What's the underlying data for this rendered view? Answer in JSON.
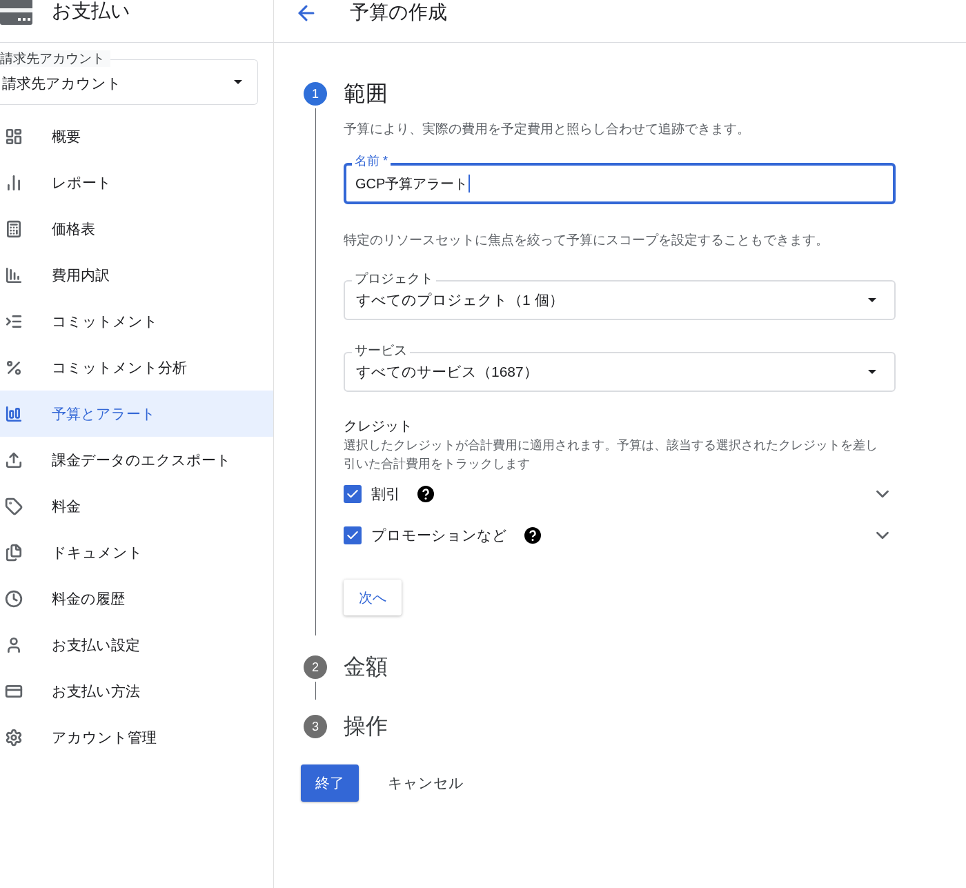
{
  "sidebar": {
    "title": "お支払い",
    "account_select": {
      "label": "請求先アカウント",
      "value": "請求先アカウント"
    },
    "items": [
      {
        "label": "概要",
        "selected": false
      },
      {
        "label": "レポート",
        "selected": false
      },
      {
        "label": "価格表",
        "selected": false
      },
      {
        "label": "費用内訳",
        "selected": false
      },
      {
        "label": "コミットメント",
        "selected": false
      },
      {
        "label": "コミットメント分析",
        "selected": false
      },
      {
        "label": "予算とアラート",
        "selected": true
      },
      {
        "label": "課金データのエクスポート",
        "selected": false
      },
      {
        "label": "料金",
        "selected": false
      },
      {
        "label": "ドキュメント",
        "selected": false
      },
      {
        "label": "料金の履歴",
        "selected": false
      },
      {
        "label": "お支払い設定",
        "selected": false
      },
      {
        "label": "お支払い方法",
        "selected": false
      },
      {
        "label": "アカウント管理",
        "selected": false
      }
    ]
  },
  "header": {
    "title": "予算の作成"
  },
  "steps": [
    {
      "number": "1",
      "title": "範囲",
      "active": true
    },
    {
      "number": "2",
      "title": "金額",
      "active": false
    },
    {
      "number": "3",
      "title": "操作",
      "active": false
    }
  ],
  "scope": {
    "description": "予算により、実際の費用を予定費用と照らし合わせて追跡できます。",
    "name_field": {
      "label": "名前 *",
      "value": "GCP予算アラート"
    },
    "filter_hint": "特定のリソースセットに焦点を絞って予算にスコープを設定することもできます。",
    "selects": [
      {
        "label": "プロジェクト",
        "value": "すべてのプロジェクト（1 個）"
      },
      {
        "label": "サービス",
        "value": "すべてのサービス（1687）"
      }
    ],
    "credits": {
      "title": "クレジット",
      "description": "選択したクレジットが合計費用に適用されます。予算は、該当する選択されたクレジットを差し引いた合計費用をトラックします",
      "items": [
        {
          "label": "割引",
          "checked": true
        },
        {
          "label": "プロモーションなど",
          "checked": true
        }
      ]
    },
    "next_button": "次へ"
  },
  "actions": {
    "finish": "終了",
    "cancel": "キャンセル"
  }
}
